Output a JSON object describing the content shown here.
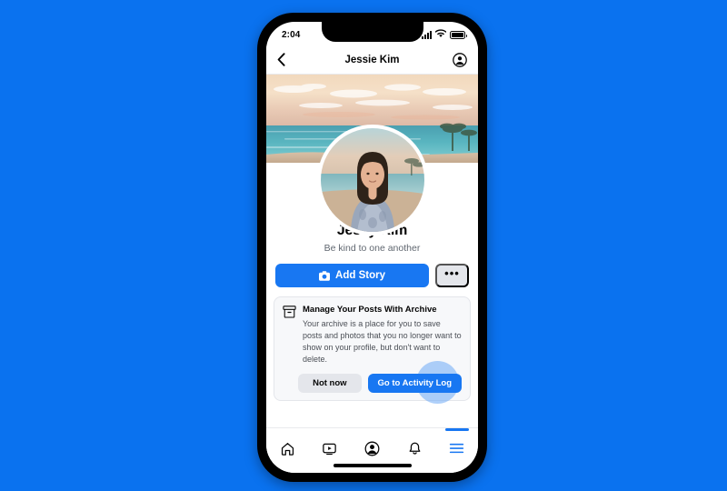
{
  "background": {
    "color": "#0a72ef"
  },
  "device": {
    "frame_color": "#000000",
    "status_bar": {
      "time": "2:04",
      "signal_icon": "signal-bars-icon",
      "wifi_icon": "wifi-icon",
      "battery_icon": "battery-full-icon"
    },
    "home_indicator": "home-indicator"
  },
  "app_header": {
    "back_icon": "chevron-left-icon",
    "title": "Jessie Kim",
    "account_icon": "account-circle-icon"
  },
  "profile": {
    "cover_photo_alt": "beach-sunset-cover-photo",
    "avatar_alt": "user-avatar-photo",
    "name": "Jessy Kim",
    "bio": "Be kind to one another"
  },
  "actions": {
    "add_story_label": "Add Story",
    "add_story_icon": "camera-icon",
    "add_story_color": "#1877f2",
    "more_label": "•••",
    "more_icon": "ellipsis-icon"
  },
  "archive_card": {
    "icon": "archive-box-icon",
    "title": "Manage Your Posts With Archive",
    "body": "Your archive is a place for you to save posts and photos that you no longer want to show on your profile, but don't want to delete.",
    "not_now_label": "Not now",
    "activity_log_label": "Go to Activity Log",
    "activity_log_color": "#1877f2",
    "tap_indicator": "tap-highlight-circle"
  },
  "bottom_nav": {
    "items": [
      {
        "name": "home",
        "icon": "home-icon",
        "active": false
      },
      {
        "name": "watch",
        "icon": "video-play-icon",
        "active": false
      },
      {
        "name": "profile",
        "icon": "profile-filled-icon",
        "active": false
      },
      {
        "name": "notifications",
        "icon": "bell-icon",
        "active": false
      },
      {
        "name": "menu",
        "icon": "hamburger-menu-icon",
        "active": true
      }
    ],
    "active_color": "#1877f2"
  }
}
